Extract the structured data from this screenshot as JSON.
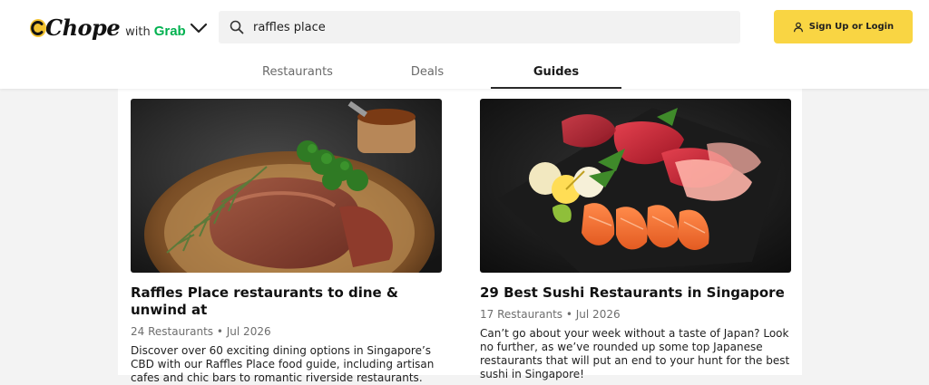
{
  "brand": {
    "logo_text": "Chope",
    "with_text": "with",
    "partner_text": "Grab",
    "partner_color": "#00b14f",
    "logo_accent": "#f2c230"
  },
  "search": {
    "value": "raffles place",
    "icon": "search-icon"
  },
  "auth": {
    "signup_label": "Sign Up or Login",
    "icon": "user-icon",
    "button_color": "#f9d543"
  },
  "tabs": [
    {
      "label": "Restaurants",
      "active": false
    },
    {
      "label": "Deals",
      "active": false
    },
    {
      "label": "Guides",
      "active": true
    }
  ],
  "guides": [
    {
      "title": "Raffles Place restaurants to dine & unwind at",
      "count": "24 Restaurants",
      "separator": "•",
      "date": "Jul 2026",
      "description": "Discover over 60 exciting dining options in Singapore’s CBD with our Raffles Place food guide, including artisan cafes and chic bars to romantic riverside restaurants.",
      "image": "steak-dish-photo"
    },
    {
      "title": "29 Best Sushi Restaurants in Singapore",
      "count": "17 Restaurants",
      "separator": "•",
      "date": "Jul 2026",
      "description": "Can’t go about your week without a taste of Japan? Look no further, as we’ve rounded up some top Japanese restaurants that will put an end to your hunt for the best sushi in Singapore!",
      "image": "sashimi-platter-photo"
    }
  ]
}
